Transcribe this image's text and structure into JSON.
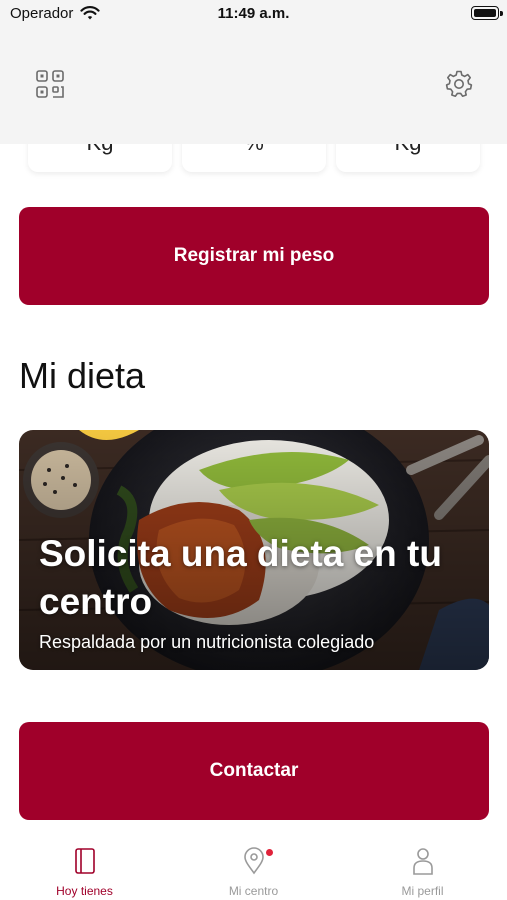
{
  "status_bar": {
    "carrier": "Operador",
    "time": "11:49 a.m."
  },
  "header": {
    "qr_icon": "qr-code-icon",
    "settings_icon": "gear-icon"
  },
  "stats": [
    {
      "unit": "Kg"
    },
    {
      "unit": "%"
    },
    {
      "unit": "Kg"
    }
  ],
  "weight_button": {
    "label": "Registrar mi peso"
  },
  "diet_section": {
    "title": "Mi dieta",
    "banner_title": "Solicita una dieta en tu centro",
    "banner_subtitle": "Respaldada por un nutricionista colegiado"
  },
  "contact_button": {
    "label": "Contactar"
  },
  "tab_bar": {
    "tabs": [
      {
        "label": "Hoy tienes",
        "icon": "notebook-icon",
        "active": true
      },
      {
        "label": "Mi centro",
        "icon": "location-pin-icon",
        "active": false,
        "badge": true
      },
      {
        "label": "Mi perfil",
        "icon": "person-icon",
        "active": false
      }
    ]
  },
  "colors": {
    "primary": "#a0002a",
    "inactive_tab": "#9a9a9a",
    "badge": "#e0223a"
  }
}
